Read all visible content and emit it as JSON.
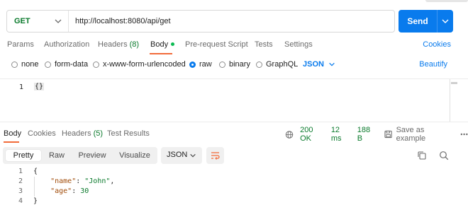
{
  "request": {
    "method": "GET",
    "url": "http://localhost:8080/api/get",
    "send_label": "Send"
  },
  "request_tabs": [
    {
      "label": "Params"
    },
    {
      "label": "Authorization"
    },
    {
      "label": "Headers",
      "count": "(8)"
    },
    {
      "label": "Body",
      "active": true
    },
    {
      "label": "Pre-request Script"
    },
    {
      "label": "Tests"
    },
    {
      "label": "Settings"
    }
  ],
  "cookies_label": "Cookies",
  "body_types": [
    {
      "label": "none",
      "selected": false
    },
    {
      "label": "form-data",
      "selected": false
    },
    {
      "label": "x-www-form-urlencoded",
      "selected": false
    },
    {
      "label": "raw",
      "selected": true
    },
    {
      "label": "binary",
      "selected": false
    },
    {
      "label": "GraphQL",
      "selected": false
    }
  ],
  "raw_format": "JSON",
  "beautify_label": "Beautify",
  "request_body": {
    "line_numbers": [
      "1"
    ],
    "lines": [
      "{}"
    ]
  },
  "response_tabs": [
    {
      "label": "Body",
      "active": true
    },
    {
      "label": "Cookies"
    },
    {
      "label": "Headers",
      "count": "(5)"
    },
    {
      "label": "Test Results"
    }
  ],
  "response_status": {
    "code": "200 OK",
    "time": "12 ms",
    "size": "188 B",
    "save_label": "Save as example"
  },
  "view_modes": [
    {
      "label": "Pretty",
      "active": true
    },
    {
      "label": "Raw"
    },
    {
      "label": "Preview"
    },
    {
      "label": "Visualize"
    }
  ],
  "response_format": "JSON",
  "response_body": {
    "line_numbers": [
      "1",
      "2",
      "3",
      "4"
    ],
    "open_brace": "{",
    "close_brace": "}",
    "name_key": "\"name\"",
    "name_value": "\"John\"",
    "age_key": "\"age\"",
    "age_value": "30"
  },
  "colors": {
    "accent_blue": "#097bed",
    "method_green": "#0a7a2c",
    "tab_underline": "#f26b3a"
  }
}
